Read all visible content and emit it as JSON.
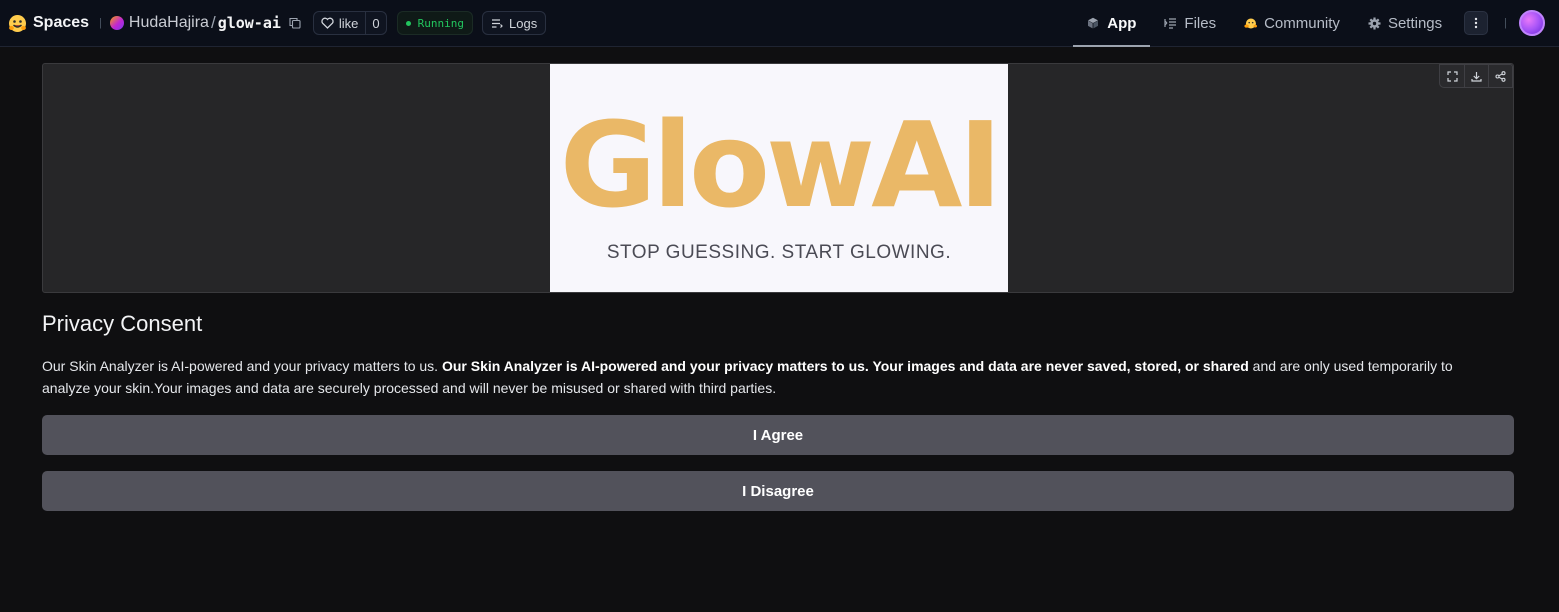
{
  "nav": {
    "brand": "Spaces",
    "owner": "HudaHajira",
    "separator": "/",
    "repo": "glow-ai",
    "like_label": "like",
    "like_count": "0",
    "status": "Running",
    "logs_label": "Logs",
    "tabs": [
      {
        "label": "App",
        "icon": "cube-icon",
        "active": true
      },
      {
        "label": "Files",
        "icon": "files-icon",
        "active": false
      },
      {
        "label": "Community",
        "icon": "community-icon",
        "active": false
      },
      {
        "label": "Settings",
        "icon": "gear-icon",
        "active": false
      }
    ],
    "menu_icon": "vertical-dots-icon"
  },
  "banner": {
    "wordmark": "GlowAI",
    "tagline": "STOP GUESSING. START GLOWING.",
    "wordmark_color": "#eab867"
  },
  "image_tools": [
    "fullscreen-icon",
    "download-icon",
    "share-icon"
  ],
  "consent": {
    "heading": "Privacy Consent",
    "text_intro": "Our Skin Analyzer is AI-powered and your privacy matters to us. ",
    "text_bold": "Our Skin Analyzer is AI-powered and your privacy matters to us. Your images and data are never saved, stored, or shared",
    "text_tail": " and are only used temporarily to analyze your skin.Your images and data are securely processed and will never be misused or shared with third parties.",
    "agree_label": "I Agree",
    "disagree_label": "I Disagree"
  },
  "colors": {
    "background": "#0f0f11",
    "button": "#52525b",
    "status": "#22c55e"
  }
}
